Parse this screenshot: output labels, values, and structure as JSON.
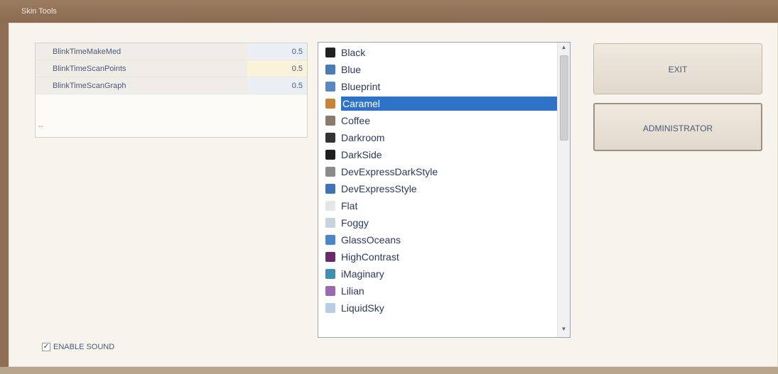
{
  "window": {
    "title": "Skin Tools"
  },
  "property_grid": {
    "rows": [
      {
        "name": "BlinkTimeMakeMed",
        "value": "0.5"
      },
      {
        "name": "BlinkTimeScanPoints",
        "value": "0.5"
      },
      {
        "name": "BlinkTimeScanGraph",
        "value": "0.5"
      }
    ],
    "selected_row": 1,
    "empty_marker": "--"
  },
  "skin_list": {
    "items": [
      {
        "label": "Black",
        "icon": "black-skin-icon",
        "color": "#222222"
      },
      {
        "label": "Blue",
        "icon": "blue-skin-icon",
        "color": "#4a79b8"
      },
      {
        "label": "Blueprint",
        "icon": "blueprint-skin-icon",
        "color": "#5b86c4"
      },
      {
        "label": "Caramel",
        "icon": "caramel-skin-icon",
        "color": "#c8833b"
      },
      {
        "label": "Coffee",
        "icon": "coffee-skin-icon",
        "color": "#8a7a66"
      },
      {
        "label": "Darkroom",
        "icon": "darkroom-skin-icon",
        "color": "#333333"
      },
      {
        "label": "DarkSide",
        "icon": "darkside-skin-icon",
        "color": "#1f1f1f"
      },
      {
        "label": "DevExpressDarkStyle",
        "icon": "devexpress-dark-skin-icon",
        "color": "#8b8b8b"
      },
      {
        "label": "DevExpressStyle",
        "icon": "devexpress-skin-icon",
        "color": "#3f73b6"
      },
      {
        "label": "Flat",
        "icon": "flat-skin-icon",
        "color": "#e6e6e6"
      },
      {
        "label": "Foggy",
        "icon": "foggy-skin-icon",
        "color": "#c9d3e0"
      },
      {
        "label": "GlassOceans",
        "icon": "glass-oceans-skin-icon",
        "color": "#4a86c8"
      },
      {
        "label": "HighContrast",
        "icon": "high-contrast-skin-icon",
        "color": "#6a2a6a"
      },
      {
        "label": "iMaginary",
        "icon": "imaginary-skin-icon",
        "color": "#3f8fb0"
      },
      {
        "label": "Lilian",
        "icon": "lilian-skin-icon",
        "color": "#9a6ab0"
      },
      {
        "label": "LiquidSky",
        "icon": "liquid-sky-skin-icon",
        "color": "#b8cde6"
      }
    ],
    "selected_index": 3
  },
  "buttons": {
    "exit_label": "EXIT",
    "admin_label": "ADMINISTRATOR"
  },
  "sound": {
    "label": "ENABLE SOUND",
    "checked": true
  },
  "colors": {
    "selection": "#2f73c9",
    "window_frame": "#8e6f55",
    "content_bg": "#f7f4ee"
  }
}
